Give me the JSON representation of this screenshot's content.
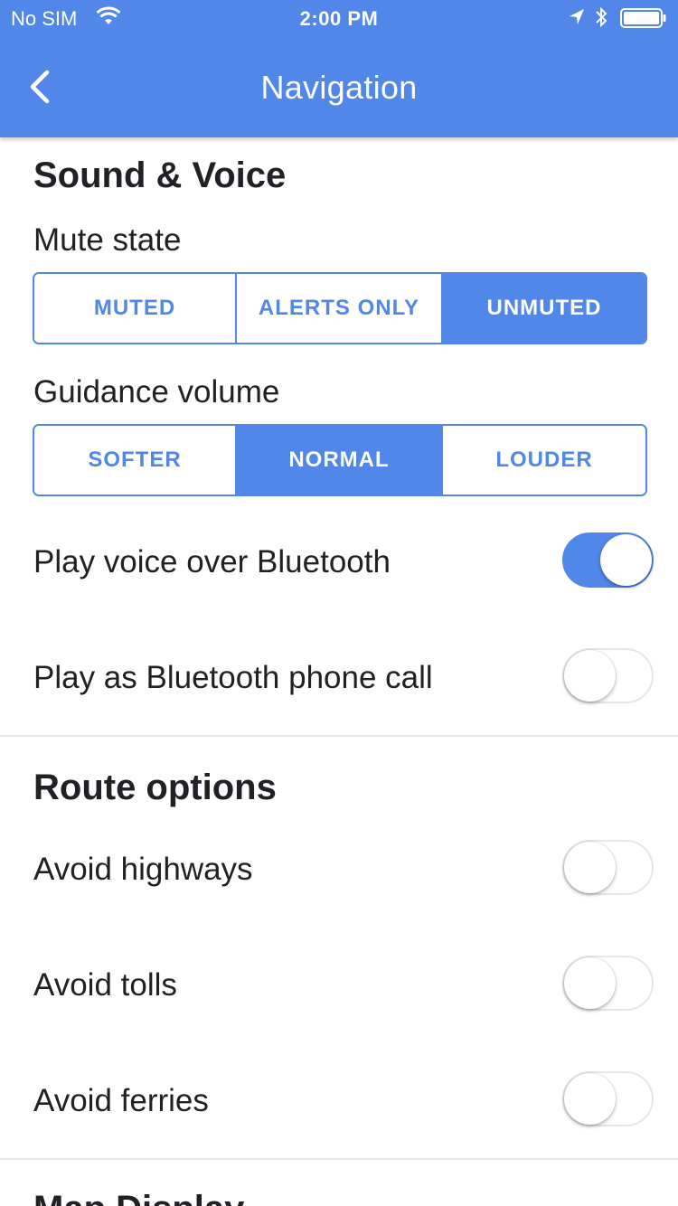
{
  "status_bar": {
    "carrier": "No SIM",
    "time": "2:00 PM"
  },
  "header": {
    "title": "Navigation"
  },
  "sound_voice": {
    "section_title": "Sound & Voice",
    "mute_state": {
      "label": "Mute state",
      "options": [
        "MUTED",
        "ALERTS ONLY",
        "UNMUTED"
      ],
      "selected": "UNMUTED"
    },
    "guidance_volume": {
      "label": "Guidance volume",
      "options": [
        "SOFTER",
        "NORMAL",
        "LOUDER"
      ],
      "selected": "NORMAL"
    },
    "play_voice_bluetooth": {
      "label": "Play voice over Bluetooth",
      "on": true
    },
    "play_bluetooth_call": {
      "label": "Play as Bluetooth phone call",
      "on": false
    }
  },
  "route_options": {
    "section_title": "Route options",
    "avoid_highways": {
      "label": "Avoid highways",
      "on": false
    },
    "avoid_tolls": {
      "label": "Avoid tolls",
      "on": false
    },
    "avoid_ferries": {
      "label": "Avoid ferries",
      "on": false
    }
  },
  "map_display": {
    "section_title": "Map Display"
  },
  "colors": {
    "accent": "#5087e8",
    "text": "#202124"
  }
}
